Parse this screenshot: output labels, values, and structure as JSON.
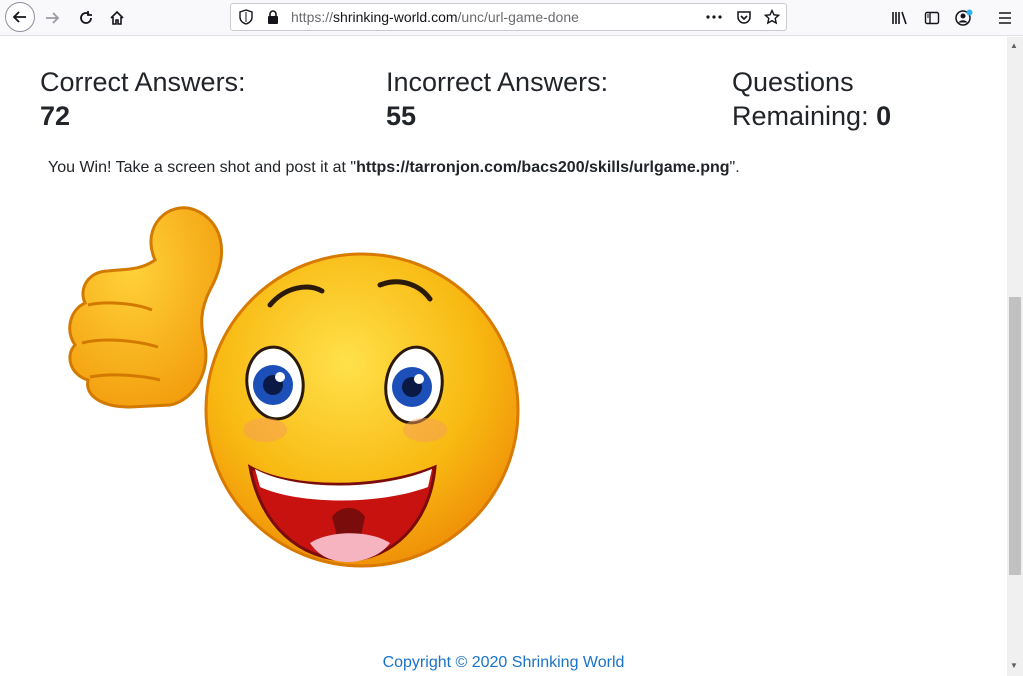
{
  "browser": {
    "url_scheme": "https://",
    "url_host": "shrinking-world.com",
    "url_path": "/unc/url-game-done",
    "icons": [
      "back-icon",
      "forward-icon",
      "reload-icon",
      "home-icon",
      "shield-icon",
      "lock-icon",
      "page-actions-icon",
      "pocket-icon",
      "bookmark-star-icon",
      "library-icon",
      "sidebar-icon",
      "account-icon",
      "menu-icon"
    ]
  },
  "stats": {
    "correct_label": "Correct Answers:",
    "correct_value": "72",
    "incorrect_label": "Incorrect Answers:",
    "incorrect_value": "55",
    "remaining_label_line1": "Questions",
    "remaining_label_line2": "Remaining:",
    "remaining_value": "0"
  },
  "message": {
    "prefix": "You Win! Take a screen shot and post it at \"",
    "link": "https://tarronjon.com/bacs200/skills/urlgame.png",
    "suffix": "\"."
  },
  "image": {
    "name": "thumbs-up-smiley-emoji"
  },
  "footer": {
    "copyright": "Copyright © 2020 Shrinking World"
  },
  "colors": {
    "link_blue": "#1a73c9",
    "text": "#212529",
    "emoji_yellow": "#f6b60f"
  }
}
